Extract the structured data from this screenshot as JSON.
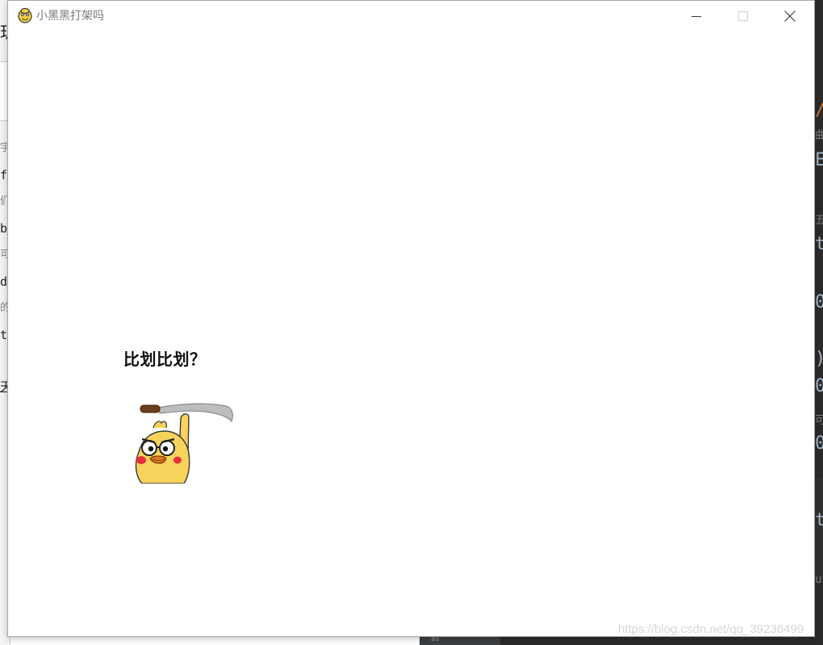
{
  "window": {
    "title": "小黑黑打架吗",
    "icon": "pygame-snake-icon",
    "controls": {
      "minimize": "minimize-icon",
      "maximize": "maximize-icon",
      "close": "close-icon"
    }
  },
  "canvas": {
    "caption": "比划比划？",
    "sticker": "duck-with-sword-sticker"
  },
  "watermark": "https://blog.csdn.net/qq_39236499",
  "background": {
    "left_fragments": [
      "玑",
      "宇",
      "f",
      "们",
      "b",
      "可",
      "d",
      "的",
      "t",
      "天"
    ],
    "right_fragments": [
      "/",
      "曲",
      "E",
      "五",
      "t",
      "0",
      ")",
      "0",
      "可",
      "0",
      "t",
      "u"
    ],
    "bottom_fragment": "av"
  },
  "colors": {
    "title_text": "#7a7a7a",
    "caption_text": "#111111",
    "duck_body": "#f7d35c",
    "duck_cheek": "#e8303a",
    "duck_beak": "#e07a1f",
    "blade": "#b9b9b9",
    "ide_background": "#2b2b2b"
  }
}
